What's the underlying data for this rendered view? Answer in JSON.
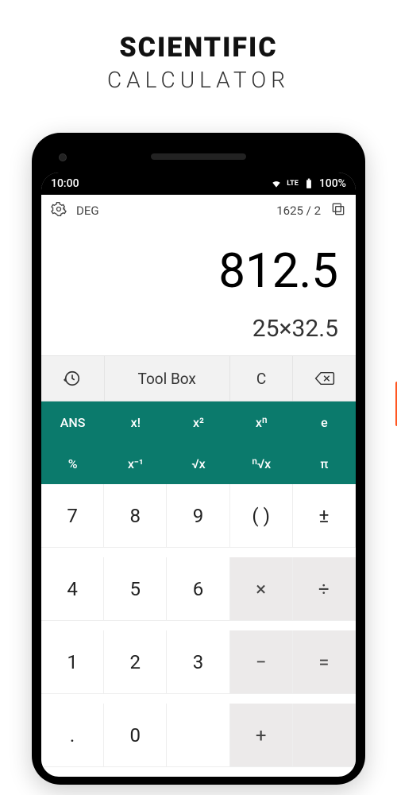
{
  "header": {
    "title1": "SCIENTIFIC",
    "title2": "CALCULATOR"
  },
  "status": {
    "time": "10:00",
    "lte": "LTE",
    "battery": "100%"
  },
  "topbar": {
    "mode": "DEG",
    "fraction": "1625 / 2"
  },
  "display": {
    "result": "812.5",
    "expression": "25×32.5"
  },
  "util": {
    "toolbox": "Tool Box",
    "clear": "C"
  },
  "sci": {
    "r0": [
      "ANS",
      "x!",
      "x²",
      "xⁿ",
      "e"
    ],
    "r1": [
      "%",
      "x⁻¹",
      "√x",
      "ⁿ√x",
      "π"
    ]
  },
  "num": {
    "r0": [
      "7",
      "8",
      "9",
      "( )",
      "±"
    ],
    "r1": [
      "4",
      "5",
      "6",
      "×",
      "÷"
    ],
    "r2": [
      "1",
      "2",
      "3",
      "−",
      "="
    ],
    "r3": [
      ".",
      "0",
      "",
      "+",
      ""
    ]
  }
}
